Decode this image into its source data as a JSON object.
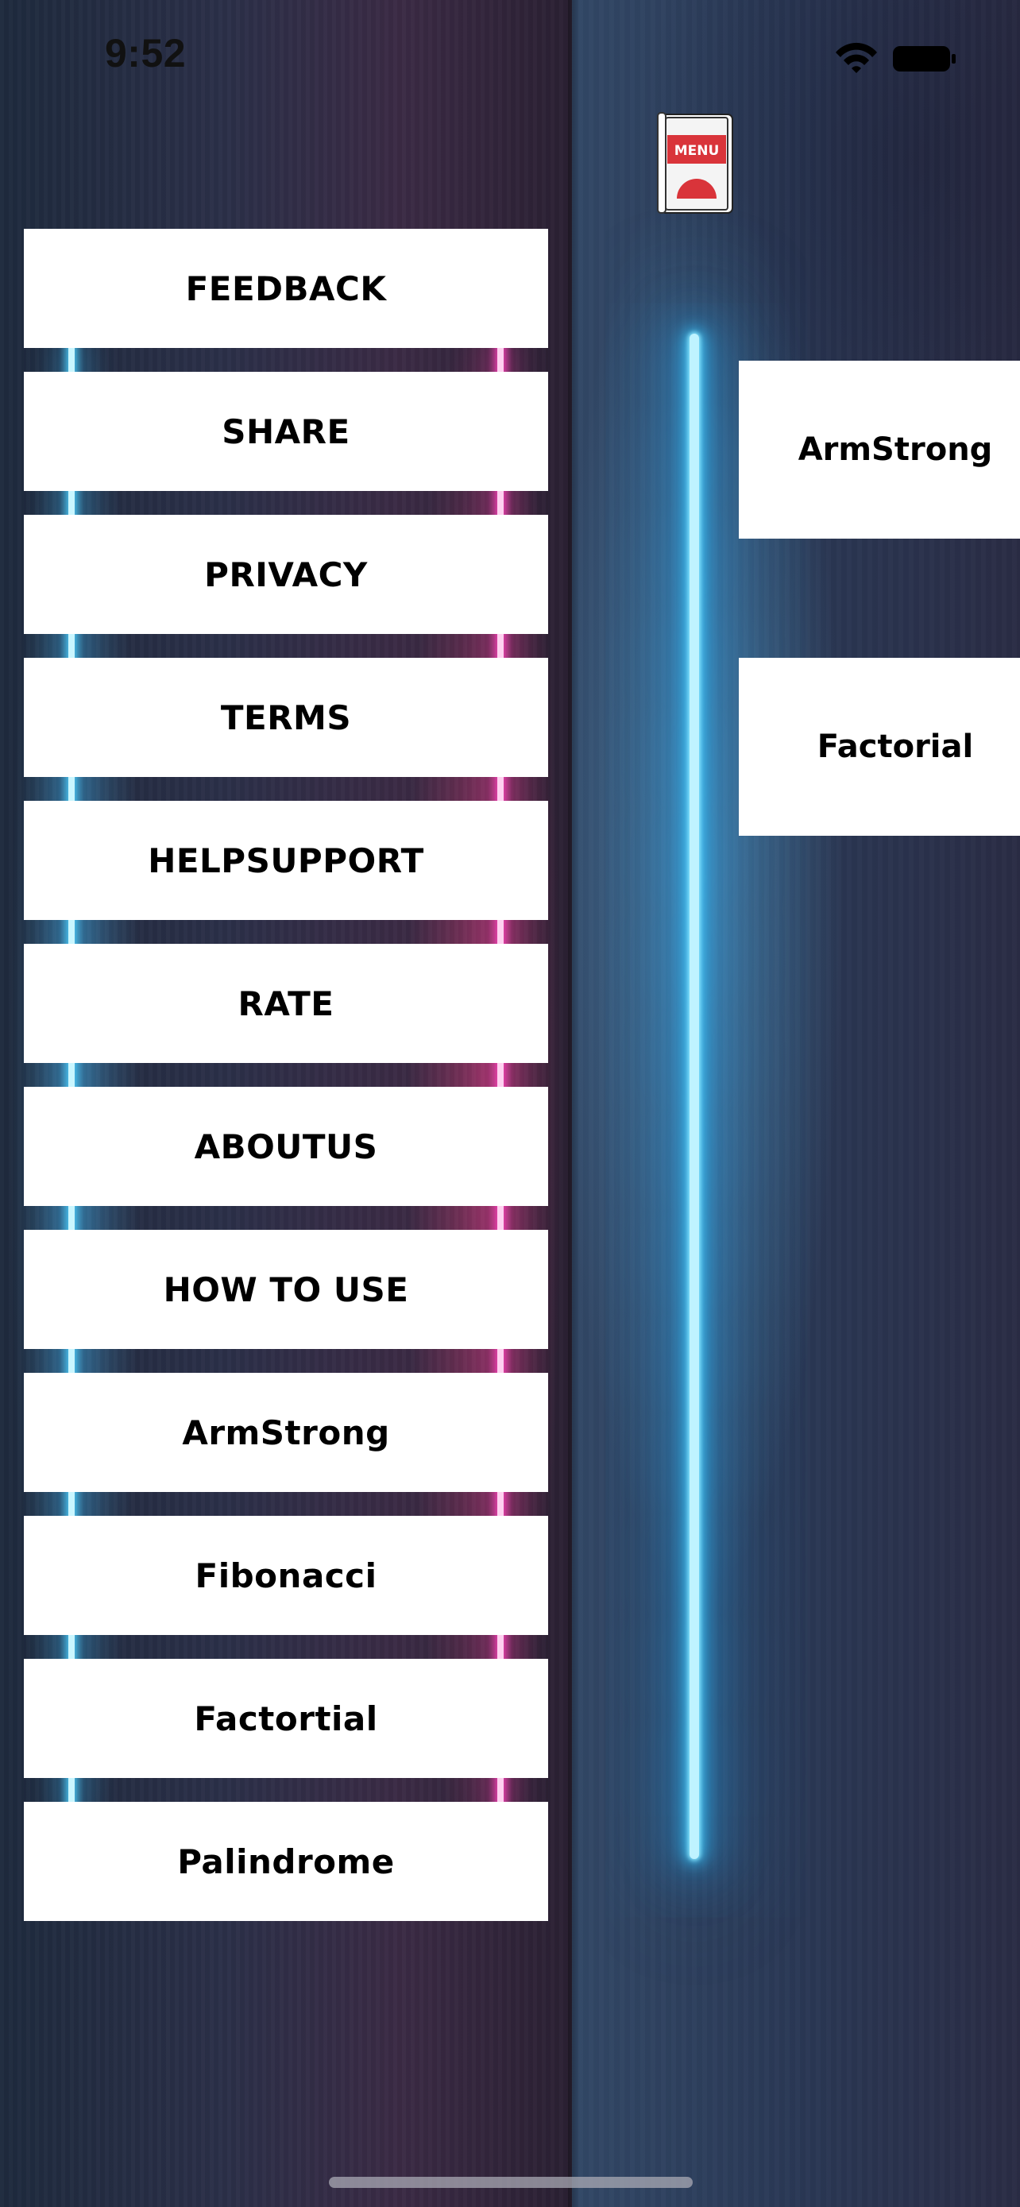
{
  "status_bar": {
    "time": "9:52"
  },
  "logo": {
    "label": "MENU",
    "colors": {
      "band": "#d9343a",
      "frame": "#ffffff",
      "emblem": "#d9343a"
    }
  },
  "drawer": {
    "items": [
      {
        "label": "FEEDBACK"
      },
      {
        "label": "SHARE"
      },
      {
        "label": "PRIVACY"
      },
      {
        "label": "TERMS"
      },
      {
        "label": "HELPSUPPORT"
      },
      {
        "label": "RATE"
      },
      {
        "label": "ABOUTUS"
      },
      {
        "label": "HOW TO USE"
      },
      {
        "label": "ArmStrong"
      },
      {
        "label": "Fibonacci"
      },
      {
        "label": "Factortial"
      },
      {
        "label": "Palindrome"
      }
    ]
  },
  "main": {
    "cards": [
      {
        "label": "ArmStrong"
      },
      {
        "label": "Factorial"
      }
    ]
  },
  "colors": {
    "button_bg": "#ffffff",
    "button_text": "#000000",
    "neon_cyan": "#3ac8ff",
    "neon_pink": "#ff46be"
  }
}
